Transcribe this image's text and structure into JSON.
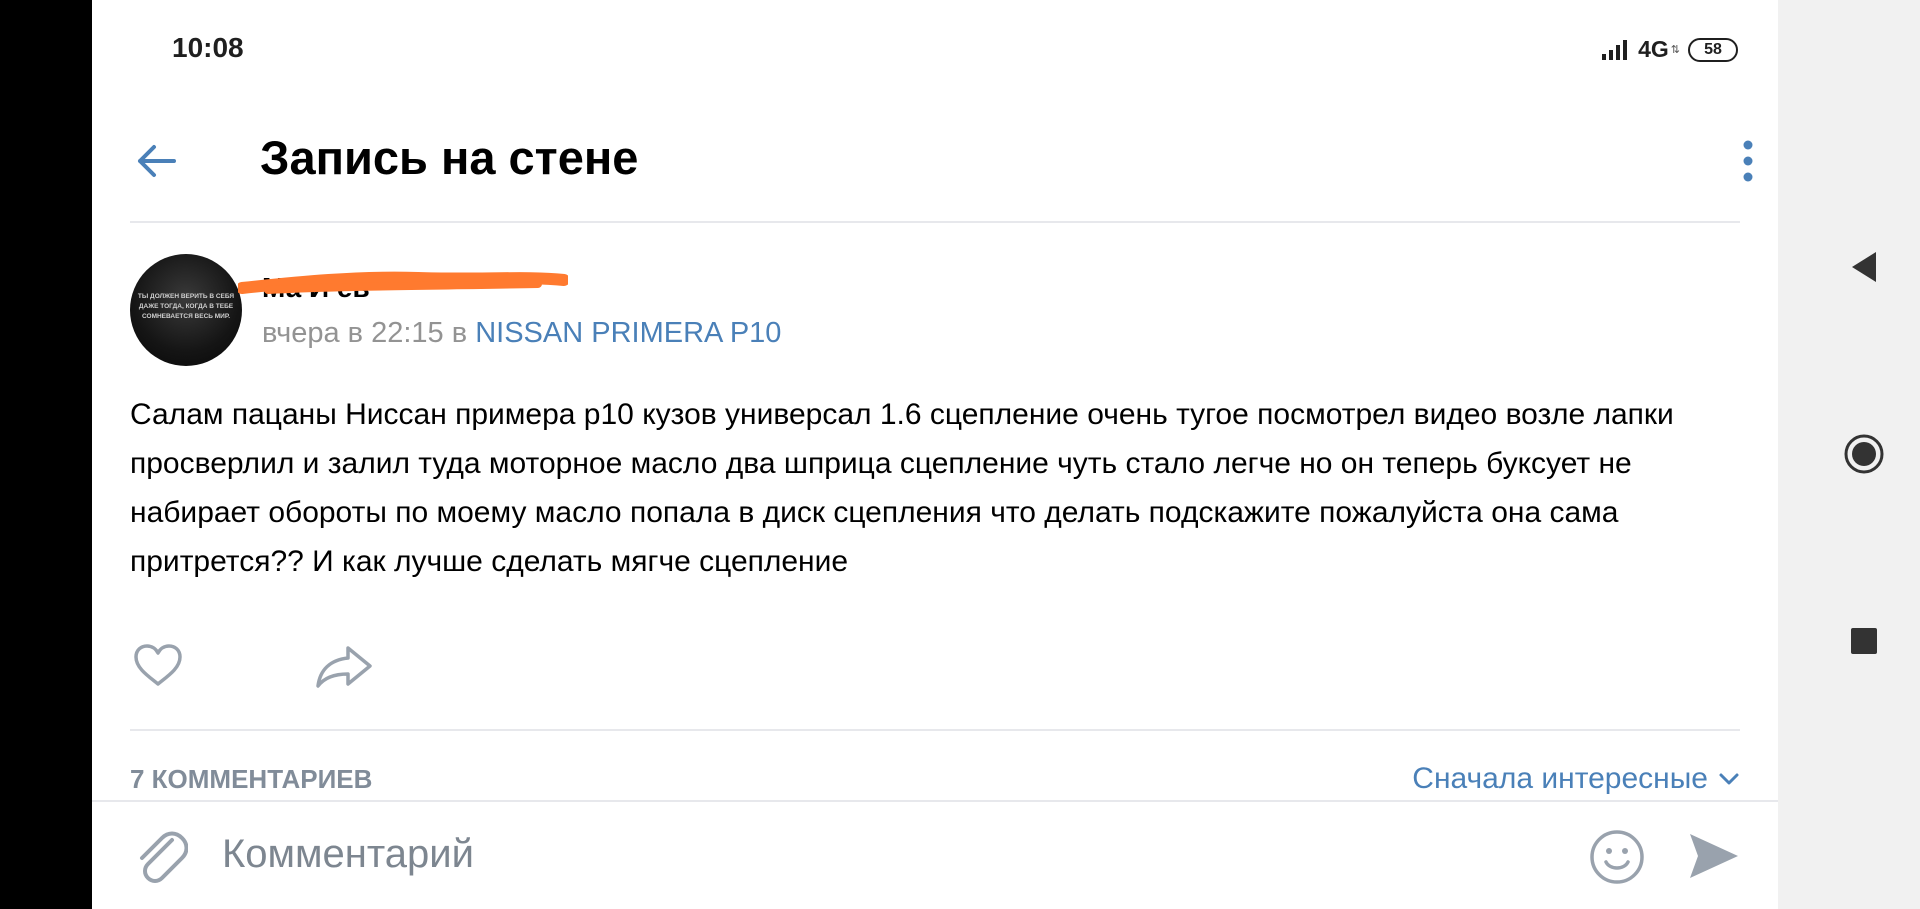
{
  "status_bar": {
    "time": "10:08",
    "network": "4G",
    "network_sub": "⇅",
    "battery": "58"
  },
  "header": {
    "title": "Запись на стене"
  },
  "post": {
    "author_name": "Ма         И          ев",
    "time": "вчера в 22:15 в ",
    "group": "NISSAN PRIMERA P10",
    "avatar_text": "ТЫ ДОЛЖЕН ВЕРИТЬ В СЕБЯ ДАЖЕ ТОГДА, КОГДА В ТЕБЕ СОМНЕВАЕТСЯ ВЕСЬ МИР.",
    "text": "Салам пацаны Ниссан примера р10 кузов универсал 1.6 сцепление очень тугое посмотрел видео возле лапки просверлил и залил туда моторное масло два шприца сцепление чуть стало легче но он теперь буксует не набирает обороты по моему масло попала в диск сцепления что делать подскажите пожалуйста она сама притрется?? И как лучше сделать мягче сцепление"
  },
  "comments": {
    "count_label": "7 КОММЕНТАРИЕВ",
    "sort_label": "Сначала интересные"
  },
  "composer": {
    "placeholder": "Комментарий"
  },
  "colors": {
    "accent": "#4a80b8",
    "muted": "#818c99",
    "redaction": "#ff7a2f"
  }
}
